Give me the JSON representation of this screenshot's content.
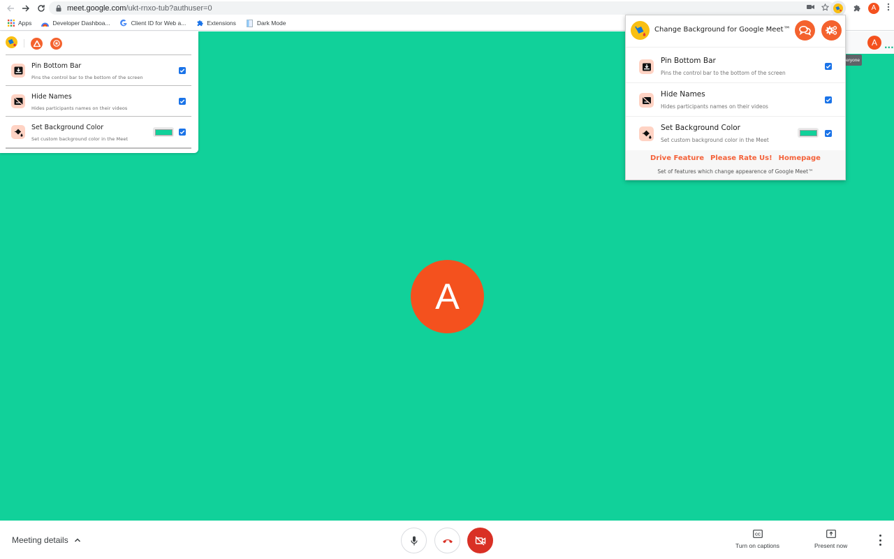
{
  "browser": {
    "url_host": "meet.google.com",
    "url_path": "/ukt-rnxo-tub?authuser=0",
    "profile_initial": "A",
    "bookmarks": [
      {
        "label": "Apps",
        "icon": "apps-grid-icon"
      },
      {
        "label": "Developer Dashboa...",
        "icon": "developer-dashboard-icon"
      },
      {
        "label": "Client ID for Web a...",
        "icon": "google-g-icon"
      },
      {
        "label": "Extensions",
        "icon": "puzzle-icon"
      },
      {
        "label": "Dark Mode",
        "icon": "document-icon"
      }
    ]
  },
  "meet": {
    "participant_initial": "A",
    "header_avatar_initial": "A",
    "tooltip_text": "eryone",
    "background_color": "#11d19a",
    "bottom_bar": {
      "meeting_details_label": "Meeting details",
      "captions_label": "Turn on captions",
      "present_label": "Present now"
    }
  },
  "left_panel": {
    "features": [
      {
        "title": "Pin Bottom Bar",
        "description": "Pins the control bar to the bottom of the screen",
        "checked": true
      },
      {
        "title": "Hide Names",
        "description": "Hides participants names on their videos",
        "checked": true
      },
      {
        "title": "Set Background Color",
        "description": "Set custom background color in the Meet",
        "checked": true,
        "color": "#11d19a"
      }
    ]
  },
  "popup": {
    "title": "Change Background for Google Meet™",
    "features": [
      {
        "title": "Pin Bottom Bar",
        "description": "Pins the control bar to the bottom of the screen",
        "checked": true
      },
      {
        "title": "Hide Names",
        "description": "Hides participants names on their videos",
        "checked": true
      },
      {
        "title": "Set Background Color",
        "description": "Set custom background color in the Meet",
        "checked": true,
        "color": "#11d19a"
      }
    ],
    "links": [
      "Drive Feature",
      "Please Rate Us!",
      "Homepage"
    ],
    "tagline": "Set of features which change appearence of Google Meet™"
  },
  "colors": {
    "accent": "#f4622e",
    "meet_avatar": "#f4511e",
    "checkbox": "#1a73e8",
    "end_call_red": "#d93025",
    "stage_green": "#11d19a"
  }
}
